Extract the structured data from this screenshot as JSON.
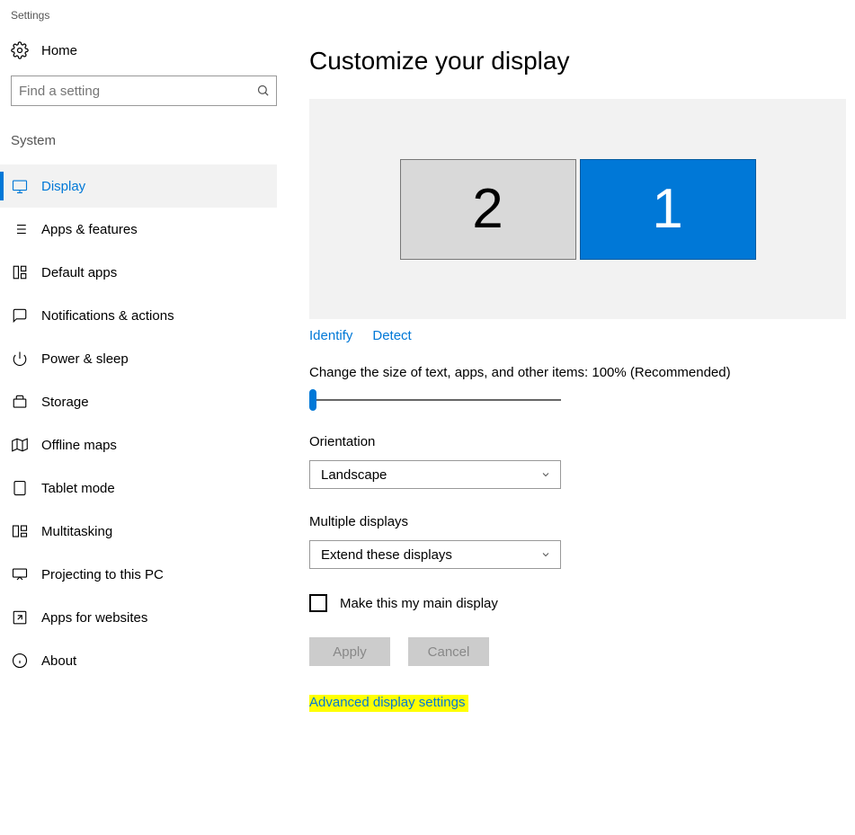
{
  "window_title": "Settings",
  "sidebar": {
    "home": "Home",
    "search_placeholder": "Find a setting",
    "section": "System",
    "items": [
      {
        "label": "Display"
      },
      {
        "label": "Apps & features"
      },
      {
        "label": "Default apps"
      },
      {
        "label": "Notifications & actions"
      },
      {
        "label": "Power & sleep"
      },
      {
        "label": "Storage"
      },
      {
        "label": "Offline maps"
      },
      {
        "label": "Tablet mode"
      },
      {
        "label": "Multitasking"
      },
      {
        "label": "Projecting to this PC"
      },
      {
        "label": "Apps for websites"
      },
      {
        "label": "About"
      }
    ]
  },
  "main": {
    "title": "Customize your display",
    "monitors": {
      "left": "2",
      "right": "1"
    },
    "identify": "Identify",
    "detect": "Detect",
    "size_label": "Change the size of text, apps, and other items: 100% (Recommended)",
    "orientation_label": "Orientation",
    "orientation_value": "Landscape",
    "multiple_label": "Multiple displays",
    "multiple_value": "Extend these displays",
    "main_display_label": "Make this my main display",
    "apply": "Apply",
    "cancel": "Cancel",
    "advanced": "Advanced display settings"
  }
}
